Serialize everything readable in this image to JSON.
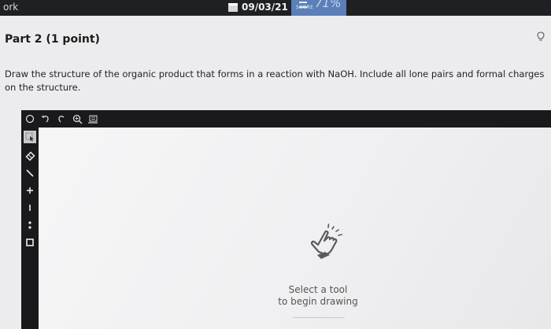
{
  "header": {
    "left_label": "ork",
    "date": "09/03/21",
    "score_label": "SCORE",
    "score_value": "71%"
  },
  "part": {
    "title": "Part 2   (1 point)"
  },
  "question": {
    "text": "Draw the structure of the organic product that forms in a reaction with NaOH. Include all lone pairs and formal charges on the structure."
  },
  "editor": {
    "toolbar_icons": [
      "clear-icon",
      "undo-icon",
      "redo-icon",
      "zoom-icon",
      "template-icon"
    ],
    "left_tools": [
      "select-tool-icon",
      "eraser-icon",
      "single-bond-icon",
      "plus-charge-icon",
      "minus-charge-icon",
      "lone-pair-icon",
      "bracket-icon"
    ],
    "placeholder_line1": "Select a tool",
    "placeholder_line2": "to begin drawing"
  },
  "colors": {
    "topbar": "#1f2023",
    "score_box": "#5b7fb8",
    "toolbar": "#1a1a1c",
    "canvas": "#f4f4f5"
  }
}
